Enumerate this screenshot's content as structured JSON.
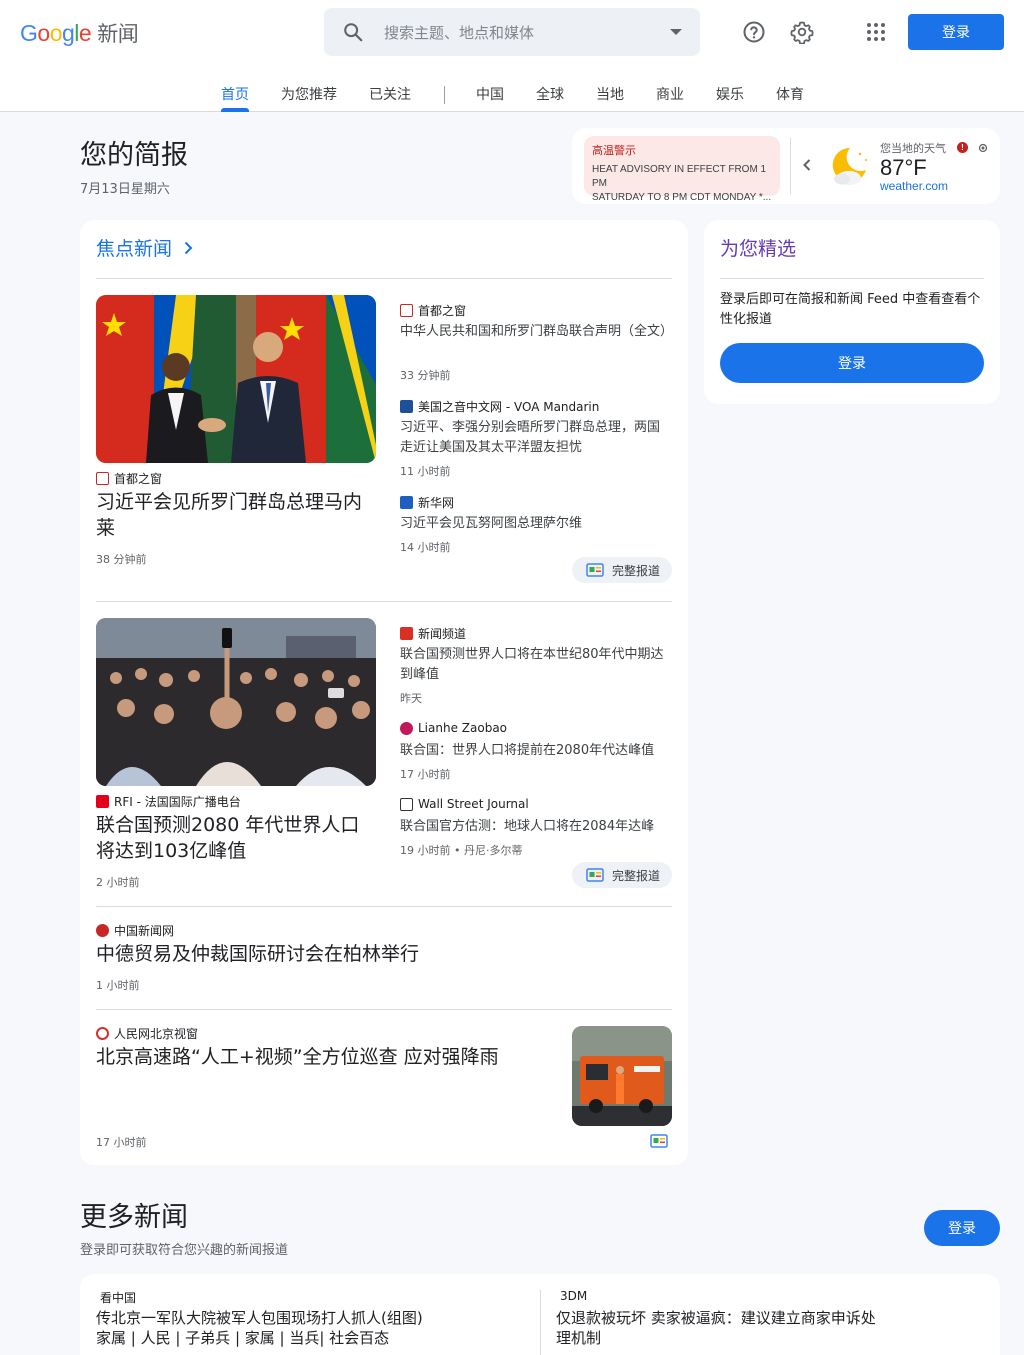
{
  "header": {
    "logo": [
      "G",
      "o",
      "o",
      "g",
      "l",
      "e"
    ],
    "product": "新闻",
    "search_placeholder": "搜索主题、地点和媒体",
    "signin": "登录"
  },
  "tabs": [
    "首页",
    "为您推荐",
    "已关注",
    "中国",
    "全球",
    "当地",
    "商业",
    "娱乐",
    "体育"
  ],
  "briefing": {
    "title": "您的简报",
    "date": "7月13日星期六"
  },
  "weather": {
    "alert_title": "高温警示",
    "alert_body_1": "HEAT ADVISORY IN EFFECT FROM 1 PM",
    "alert_body_2": "SATURDAY TO 8 PM CDT MONDAY *...",
    "label": "您当地的天气",
    "temp": "87°F",
    "source": "weather.com"
  },
  "headlines": {
    "title": "焦点新闻",
    "cluster1": {
      "main_source": "首都之窗",
      "main_title": "习近平会见所罗门群岛总理马内莱",
      "main_time": "38 分钟前",
      "items": [
        {
          "source": "首都之窗",
          "title": "中华人民共和国和所罗门群岛联合声明（全文）",
          "time": "33 分钟前"
        },
        {
          "source": "美国之音中文网 - VOA Mandarin",
          "title": "习近平、李强分别会晤所罗门群岛总理，两国走近让美国及其太平洋盟友担忧",
          "time": "11 小时前"
        },
        {
          "source": "新华网",
          "title": "习近平会见瓦努阿图总理萨尔维",
          "time": "14 小时前"
        }
      ],
      "full_coverage": "完整报道"
    },
    "cluster2": {
      "main_source": "RFI - 法国国际广播电台",
      "main_title": "联合国预测2080 年代世界人口将达到103亿峰值",
      "main_time": "2 小时前",
      "items": [
        {
          "source": "新闻频道",
          "title": "联合国预测世界人口将在本世纪80年代中期达到峰值",
          "time": "昨天"
        },
        {
          "source": "Lianhe Zaobao",
          "title": "联合国：世界人口将提前在2080年代达峰值",
          "time": "17 小时前"
        },
        {
          "source": "Wall Street Journal",
          "title": "联合国官方估测：地球人口将在2084年达峰",
          "time": "19 小时前 • 丹尼·多尔蒂"
        }
      ],
      "full_coverage": "完整报道"
    },
    "story3": {
      "source": "中国新闻网",
      "title": "中德贸易及仲裁国际研讨会在柏林举行",
      "time": "1 小时前"
    },
    "story4": {
      "source": "人民网北京视窗",
      "title": "北京高速路“人工+视频”全方位巡查 应对强降雨",
      "time": "17 小时前"
    }
  },
  "foryou": {
    "title": "为您精选",
    "text": "登录后即可在简报和新闻 Feed 中查看查看个性化报道",
    "button": "登录"
  },
  "more": {
    "title": "更多新闻",
    "subtitle": "登录即可获取符合您兴趣的新闻报道",
    "button": "登录",
    "left": {
      "source": "看中国",
      "title_1": "传北京一军队大院被军人包围现场打人抓人(组图)",
      "title_2": "家属 | 人民 | 子弟兵 | 家属 | 当兵| 社会百态"
    },
    "right": {
      "source": "3DM",
      "title_1": "仅退款被玩坏 卖家被逼疯：建议建立商家申诉处",
      "title_2": "理机制"
    }
  }
}
